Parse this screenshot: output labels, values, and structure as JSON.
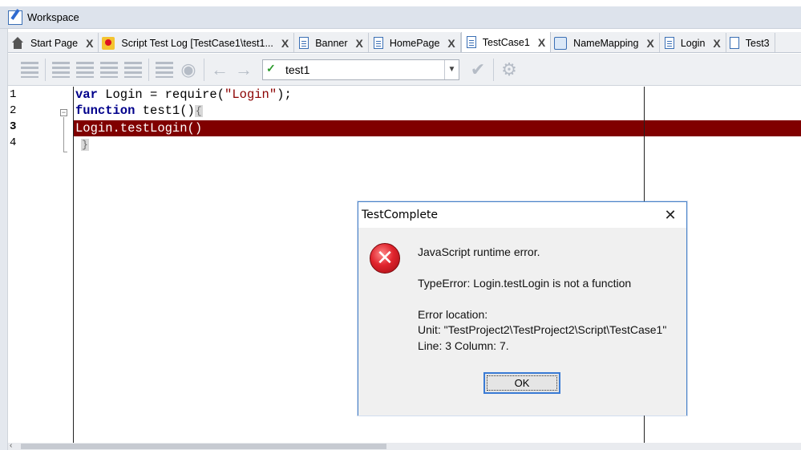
{
  "window": {
    "title": "Workspace"
  },
  "tabs": [
    {
      "label": "Start Page",
      "icon": "home-icon",
      "active": false
    },
    {
      "label": "Script Test Log [TestCase1\\test1...",
      "icon": "test-log-icon",
      "active": false
    },
    {
      "label": "Banner",
      "icon": "document-icon",
      "active": false
    },
    {
      "label": "HomePage",
      "icon": "document-icon",
      "active": false
    },
    {
      "label": "TestCase1",
      "icon": "document-icon",
      "active": true
    },
    {
      "label": "NameMapping",
      "icon": "name-mapping-icon",
      "active": false
    },
    {
      "label": "Login",
      "icon": "document-icon",
      "active": false
    },
    {
      "label": "Test3",
      "icon": "keyword-test-icon",
      "active": false
    }
  ],
  "tab_close_glyph": "X",
  "toolbar": {
    "routine_selector": {
      "selected": "test1"
    }
  },
  "editor": {
    "line_numbers": [
      "1",
      "2",
      "3",
      "4"
    ],
    "current_line": 3,
    "error_line_color": "#800000",
    "lines": {
      "l1_kw": "var",
      "l1_mid": " Login = require(",
      "l1_str": "\"Login\"",
      "l1_end": ");",
      "l2_kw": "function",
      "l2_rest": " test1()",
      "l2_brace": "{",
      "l3": "Login.testLogin()",
      "l4_brace": "}"
    }
  },
  "dialog": {
    "title": "TestComplete",
    "icon": "error-icon",
    "message": "JavaScript runtime error.",
    "error": "TypeError: Login.testLogin is not a function",
    "location_label": "Error location:",
    "unit": "Unit: \"TestProject2\\TestProject2\\Script\\TestCase1\"",
    "line_col": "Line: 3 Column: 7.",
    "ok_label": "OK",
    "close_glyph": "✕"
  }
}
